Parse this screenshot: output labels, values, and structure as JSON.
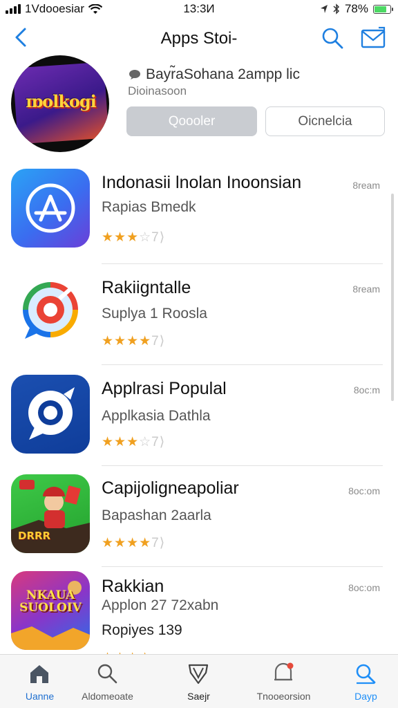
{
  "status_bar": {
    "carrier": "1Vdooesiar",
    "time": "13:3И",
    "battery": "78%",
    "battery_level": 0.78
  },
  "nav": {
    "title": "Apps Stoi-",
    "back_icon": "chevron-left-icon",
    "search_icon": "search-icon",
    "mail_icon": "mail-icon",
    "accent_color": "#1e7fe0"
  },
  "featured": {
    "art_text": "ɪɒolkogi",
    "title": "Bayr̃aSohana 2ampp lic",
    "subtitle": "Dioinasoon",
    "primary_button": "Qoooler",
    "secondary_button": "Oicnelcia"
  },
  "apps": [
    {
      "name": "Indonasii lnolan Inoonsian",
      "subtitle": "Rapias Bmedk",
      "stars": "★★★",
      "stars_rest": "☆7⟩",
      "rating": 3,
      "meta": "8ream"
    },
    {
      "name": "Rakiigntalle",
      "subtitle": "Suplya 1 Roosla",
      "stars": "★★★★",
      "stars_rest": "7⟩",
      "rating": 4,
      "meta": "8ream"
    },
    {
      "name": "Applrasi Populal",
      "subtitle": "Applkasia Dathla",
      "stars": "★★★",
      "stars_rest": "☆7⟩",
      "rating": 3,
      "meta": "8oc:m"
    },
    {
      "name": "Capijoligneapoliar",
      "subtitle": "Bapashan 2aarla",
      "stars": "★★★★",
      "stars_rest": "7⟩",
      "rating": 4,
      "meta": "8oc:om",
      "art_text": "DRRR"
    },
    {
      "name": "Rakkian",
      "subtitle": "Applon 27 72xabn",
      "extra": "Ropiyes 139",
      "stars": "★★★★",
      "stars_rest": "",
      "rating": 4,
      "meta": "8oc:om",
      "art_text": "NKAUA SUOLOIV"
    }
  ],
  "tabs": [
    {
      "label": "Uanne",
      "icon": "home-icon",
      "active": true
    },
    {
      "label": "Aldomeoate",
      "icon": "search-icon",
      "active": false
    },
    {
      "label": "Saejr",
      "icon": "shield-icon",
      "active": false
    },
    {
      "label": "Tnooeorsion",
      "icon": "notification-icon",
      "active": false
    },
    {
      "label": "Dayp",
      "icon": "search-icon",
      "active": true
    }
  ]
}
